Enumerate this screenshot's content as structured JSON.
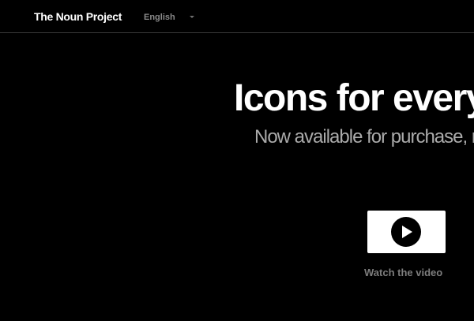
{
  "header": {
    "brand": "The Noun Project",
    "language": "English"
  },
  "hero": {
    "title": "Icons for every",
    "subtitle": "Now available for purchase, r",
    "video_caption": "Watch the video"
  },
  "colors": {
    "background": "#000000",
    "text_primary": "#ffffff",
    "text_muted": "#8a8a8a",
    "button_bg": "#ffffff",
    "play_icon": "#000000"
  },
  "icons": {
    "language_dropdown": "chevron-down-icon",
    "video": "play-icon"
  }
}
